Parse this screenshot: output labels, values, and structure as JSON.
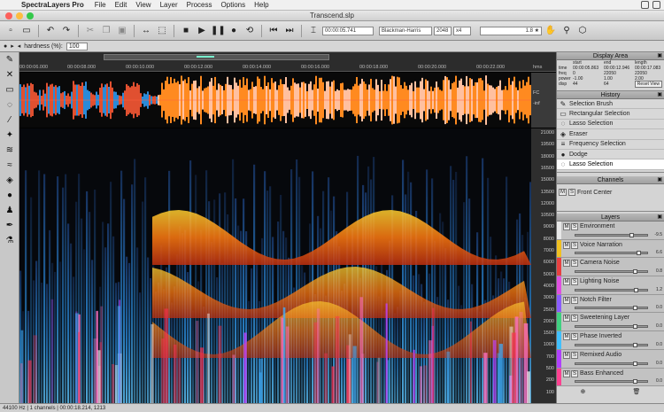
{
  "menubar": {
    "app_name": "SpectraLayers Pro",
    "items": [
      "File",
      "Edit",
      "View",
      "Layer",
      "Process",
      "Options",
      "Help"
    ]
  },
  "window": {
    "title": "Transcend.slp"
  },
  "toolbar": {
    "time_field": "00:00:05.741",
    "fft_window": "Blackman-Harris",
    "fft_size": "2048",
    "ratio": "x4",
    "gain": "1.8 ★"
  },
  "optbar": {
    "hardness_label": "hardness (%):",
    "hardness_value": "100"
  },
  "timeline": {
    "ticks": [
      "00:00:06.000",
      "00:00:08.000",
      "00:00:10.000",
      "00:00:12.000",
      "00:00:14.000",
      "00:00:16.000",
      "00:00:18.000",
      "00:00:20.000",
      "00:00:22.000"
    ],
    "unit": "hms"
  },
  "wave_ruler": [
    "FC",
    "-inf"
  ],
  "freq_ruler": [
    "21000",
    "19500",
    "18000",
    "16500",
    "15000",
    "13500",
    "12000",
    "10500",
    "9000",
    "8000",
    "7000",
    "6000",
    "5000",
    "4000",
    "3000",
    "2500",
    "2000",
    "1500",
    "1000",
    "700",
    "500",
    "200",
    "100"
  ],
  "display_area": {
    "title": "Display Area",
    "headers": [
      "",
      "start",
      "end",
      "length"
    ],
    "rows": [
      [
        "time",
        "00:00:05.863",
        "00:00:12.946",
        "00:00:17.083"
      ],
      [
        "freq",
        "0",
        "22050",
        "22050"
      ],
      [
        "power",
        "-1.00",
        "1.00",
        "2.00"
      ],
      [
        "disp",
        "44",
        "64",
        "64"
      ]
    ],
    "reset_label": "Reset View"
  },
  "history": {
    "title": "History",
    "items": [
      {
        "label": "Selection Brush",
        "icon": "brush-icon"
      },
      {
        "label": "Rectangular Selection",
        "icon": "rect-select-icon"
      },
      {
        "label": "Lasso Selection",
        "icon": "lasso-icon"
      },
      {
        "label": "Eraser",
        "icon": "eraser-icon"
      },
      {
        "label": "Frequency Selection",
        "icon": "freq-select-icon"
      },
      {
        "label": "Dodge",
        "icon": "dodge-icon"
      },
      {
        "label": "Lasso Selection",
        "icon": "lasso-icon",
        "selected": true
      }
    ]
  },
  "channels": {
    "title": "Channels",
    "items": [
      {
        "label": "Front Center"
      }
    ]
  },
  "layers": {
    "title": "Layers",
    "items": [
      {
        "name": "Environment",
        "color": "#e8e8e8",
        "value": "-9.5",
        "level": 0.75
      },
      {
        "name": "Voice Narration",
        "color": "#f0c020",
        "value": "6.6",
        "level": 0.85
      },
      {
        "name": "Camera Noise",
        "color": "#e84040",
        "value": "0.8",
        "level": 0.8
      },
      {
        "name": "Lighting Noise",
        "color": "#e050e0",
        "value": "1.2",
        "level": 0.82
      },
      {
        "name": "Notch Filter",
        "color": "#8a5cff",
        "value": "0.0",
        "level": 0.8
      },
      {
        "name": "Sweetening Layer",
        "color": "#40d080",
        "value": "0.0",
        "level": 0.8
      },
      {
        "name": "Phase Inverted",
        "color": "#40c0ff",
        "value": "0.0",
        "level": 0.8
      },
      {
        "name": "Remixed Audio",
        "color": "#b040ff",
        "value": "0.0",
        "level": 0.8
      },
      {
        "name": "Bass Enhanced",
        "color": "#ff4090",
        "value": "0.0",
        "level": 0.8
      }
    ]
  },
  "status": {
    "text": "44100 Hz | 1 channels | 00:00:18.214, 1213"
  }
}
